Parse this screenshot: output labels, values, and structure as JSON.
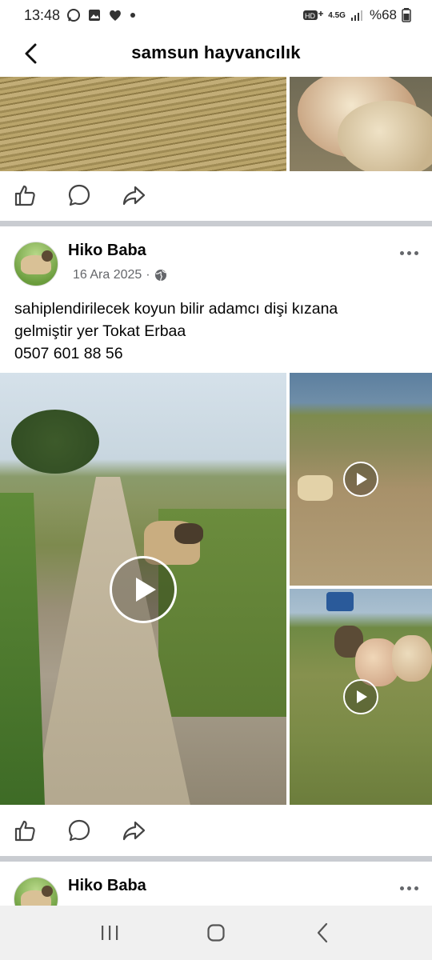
{
  "status_bar": {
    "time": "13:48",
    "network_label": "4.5G",
    "battery": "%68",
    "icons": [
      "whatsapp-icon",
      "gallery-icon",
      "heart-icon",
      "dot-icon",
      "hd-icon",
      "signal-icon",
      "battery-icon"
    ]
  },
  "header": {
    "title": "samsun hayvancılık",
    "back_icon": "chevron-left-icon"
  },
  "actions": {
    "icons": [
      "like-icon",
      "comment-icon",
      "share-icon"
    ]
  },
  "post1": {
    "author": "Hiko Baba",
    "date": "16 Ara 2025",
    "separator": "·",
    "privacy_icon": "globe-icon",
    "text_lines": [
      "sahiplendirilecek koyun bilir adamcı dişi kızana",
      "gelmiştir yer Tokat Erbaa",
      "0507 601 88 56"
    ],
    "media": [
      "video",
      "video",
      "video"
    ]
  },
  "post2": {
    "author": "Hiko Baba"
  },
  "nav": {
    "icons": [
      "recents-icon",
      "home-icon",
      "back-icon"
    ]
  },
  "colors": {
    "divider": "#c9ccd1",
    "secondary_text": "#65676b",
    "nav_bg": "#f0f0f0"
  }
}
